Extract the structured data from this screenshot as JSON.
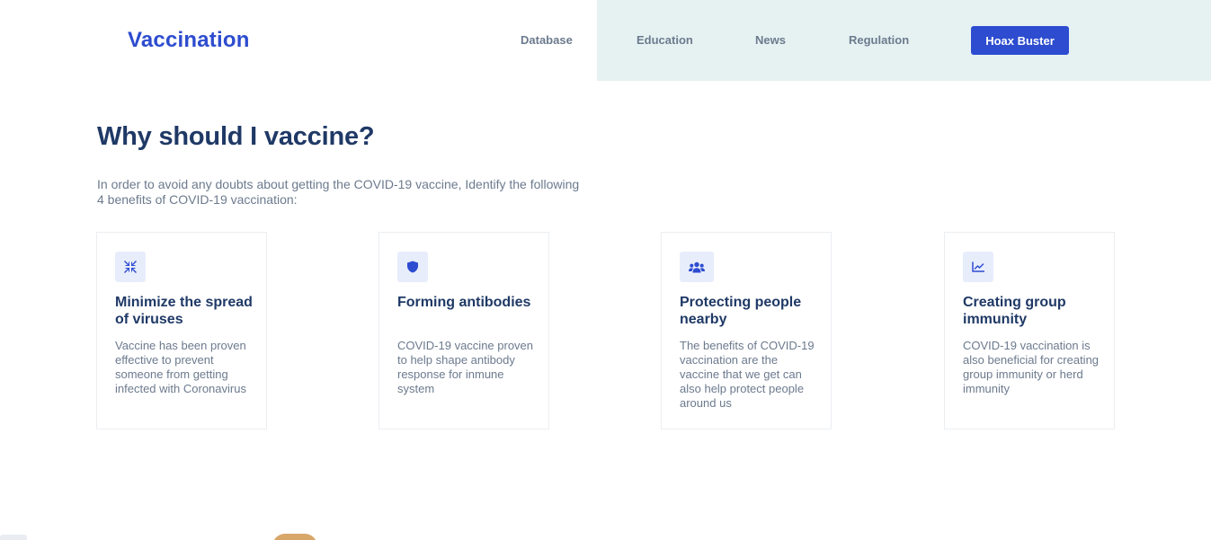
{
  "header": {
    "logo": "Vaccination",
    "nav": [
      "Database",
      "Education",
      "News",
      "Regulation"
    ],
    "cta": "Hoax Buster"
  },
  "colors": {
    "brand": "#2d4ccf",
    "heading": "#1f3966",
    "body_text": "#6c7a8e",
    "nav_background": "#e6f2f2",
    "icon_background": "#e8edfb"
  },
  "hero": {
    "title": "Why should I vaccine?",
    "intro": "In order to avoid any doubts about getting the COVID-19 vaccine, Identify the following 4 benefits of COVID-19 vaccination:"
  },
  "benefits": [
    {
      "icon": "compress-arrows-icon",
      "title": "Minimize the spread of viruses",
      "text": "Vaccine has been proven effective to prevent someone from getting infected with Coronavirus"
    },
    {
      "icon": "shield-icon",
      "title": "Forming antibodies",
      "text": "COVID-19 vaccine proven to help shape antibody response for inmune system"
    },
    {
      "icon": "users-icon",
      "title": "Protecting people nearby",
      "text": "The benefits of COVID-19 vaccination are the vaccine that we get can also help protect people around us"
    },
    {
      "icon": "line-chart-icon",
      "title": "Creating group immunity",
      "text": "COVID-19 vaccination is also beneficial for creating group immunity or herd immunity"
    }
  ]
}
